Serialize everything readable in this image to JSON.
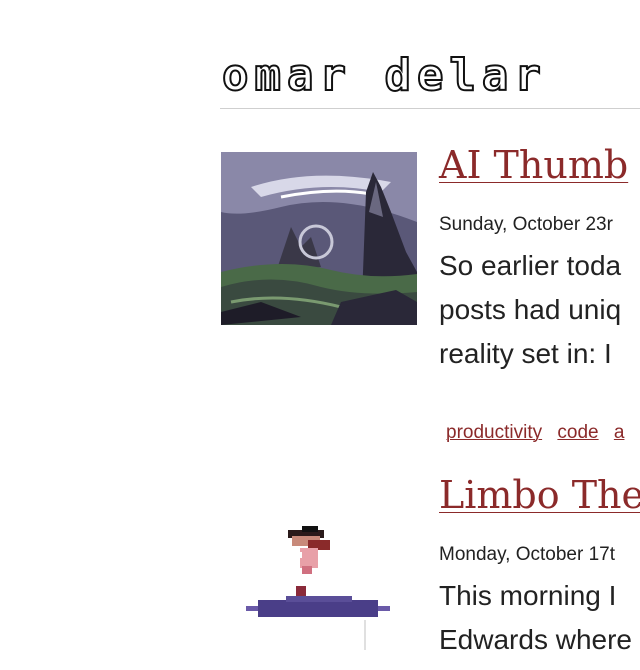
{
  "site": {
    "title": "omar delar"
  },
  "posts": [
    {
      "title": "AI Thumb",
      "date": "Sunday, October 23r",
      "excerpt": [
        "So earlier toda",
        "posts had uniq",
        "reality set in: I"
      ],
      "thumbnail_icon": "mountain-landscape-thumbnail",
      "tags": [
        "productivity",
        "code",
        "a"
      ]
    },
    {
      "title": "Limbo The",
      "date": "Monday, October 17t",
      "excerpt": [
        "This morning I",
        "Edwards where"
      ],
      "thumbnail_icon": "pixel-character-on-platform"
    }
  ],
  "colors": {
    "link": "#8b2a2a",
    "text": "#222222",
    "rule": "#cfcfcf"
  }
}
